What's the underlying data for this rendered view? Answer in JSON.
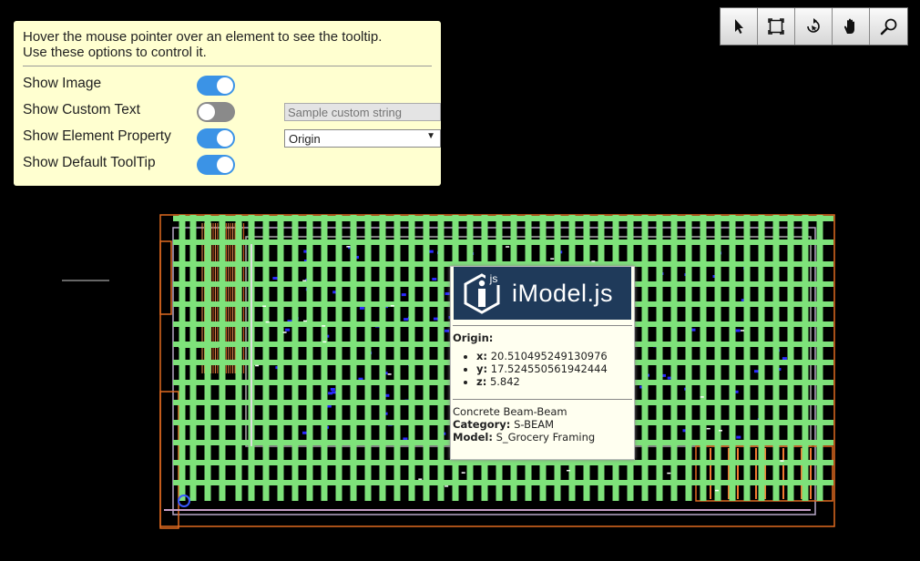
{
  "options_panel": {
    "intro_line1": "Hover the mouse pointer over an element to see the tooltip.",
    "intro_line2": "Use these options to control it.",
    "show_image": {
      "label": "Show Image",
      "on": true
    },
    "show_custom_text": {
      "label": "Show Custom Text",
      "on": false,
      "placeholder": "Sample custom string"
    },
    "show_element_property": {
      "label": "Show Element Property",
      "on": true,
      "selected": "Origin"
    },
    "show_default_tooltip": {
      "label": "Show Default ToolTip",
      "on": true
    }
  },
  "toolbar": {
    "tools": [
      "select-arrow-icon",
      "fit-view-icon",
      "rotate-view-icon",
      "pan-hand-icon",
      "zoom-magnifier-icon"
    ]
  },
  "tooltip": {
    "logo_text": "iModel.js",
    "logo_badge": "js",
    "property_title": "Origin:",
    "coords": [
      {
        "key": "x:",
        "value": "20.510495249130976"
      },
      {
        "key": "y:",
        "value": "17.524550561942444"
      },
      {
        "key": "z:",
        "value": "5.842"
      }
    ],
    "element_name": "Concrete Beam-Beam",
    "category_label": "Category:",
    "category_value": "S-BEAM",
    "model_label": "Model:",
    "model_value": "S_Grocery Framing"
  },
  "colors": {
    "panel_bg": "#ffffd0",
    "toggle_on": "#3b93e6",
    "toggle_off": "#8a8a8a",
    "beam_green": "#7ee27a",
    "outline_orange": "#e06a20",
    "detail_blue": "#2a2aff",
    "logo_bg": "#1f3a5a"
  }
}
